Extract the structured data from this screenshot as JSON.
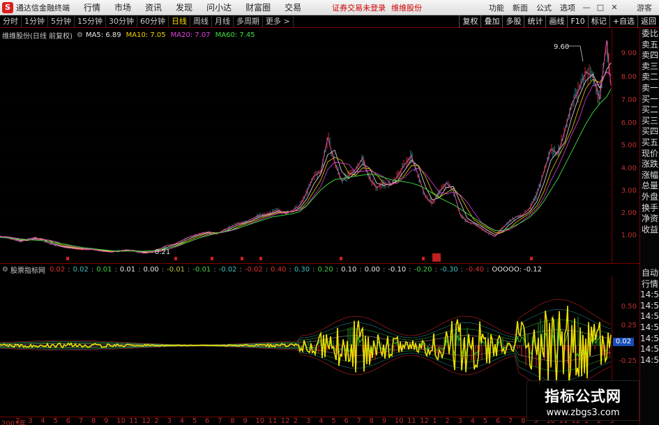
{
  "titlebar": {
    "app_name": "通达信金融终端",
    "logo_letter": "S",
    "menu": [
      "行情",
      "市场",
      "资讯",
      "发现",
      "问小达",
      "财富圈",
      "交易"
    ],
    "warning": "证券交易未登录",
    "stock_tag": "维维股份",
    "buttons": [
      "功能",
      "新面",
      "公式",
      "选项"
    ],
    "guest": "游客"
  },
  "toolbar": {
    "periods": [
      "分时",
      "1分钟",
      "5分钟",
      "15分钟",
      "30分钟",
      "60分钟",
      "日线",
      "周线",
      "月线",
      "多周期",
      "更多 >"
    ],
    "active_period": "日线",
    "right_buttons": [
      "复权",
      "叠加",
      "多股",
      "统计",
      "画线",
      "F10",
      "标记",
      "+自选",
      "返回"
    ]
  },
  "main_header": {
    "stock_name": "维维股份(日线 前复权)",
    "ma": [
      {
        "label": "MA5: 6.89",
        "color": "#e8e8e8"
      },
      {
        "label": "MA10: 7.05",
        "color": "#f0d000"
      },
      {
        "label": "MA20: 7.07",
        "color": "#e040e0"
      },
      {
        "label": "MA60: 7.45",
        "color": "#40e040"
      }
    ]
  },
  "main_axis": [
    "9.00",
    "8.00",
    "7.00",
    "6.00",
    "5.00",
    "4.00",
    "3.00",
    "2.00",
    "1.00"
  ],
  "annotations": {
    "high": "9.60",
    "low": "0.21"
  },
  "side_panel": {
    "top": [
      "委比",
      "卖五",
      "卖四",
      "卖三",
      "卖二",
      "卖一",
      "买一",
      "买二",
      "买三",
      "买四",
      "买五",
      "现价",
      "涨跌",
      "涨幅",
      "总量",
      "外盘",
      "换手",
      "净资",
      "收益"
    ],
    "bottom": [
      "自动",
      "行情",
      "14:50",
      "14:50",
      "14:50",
      "14:50",
      "14:50",
      "14:50",
      "14:50"
    ]
  },
  "indicator": {
    "name": "股票指标网",
    "values": [
      {
        "label": "0.02",
        "color": "#e03030"
      },
      {
        "label": "0.02",
        "color": "#40c0c0"
      },
      {
        "label": "0.01",
        "color": "#40d040"
      },
      {
        "label": "0.01",
        "color": "#e8e8e8"
      },
      {
        "label": "0.00",
        "color": "#e8e8e8"
      },
      {
        "label": "-0.01",
        "color": "#c0c040"
      },
      {
        "label": "-0.01",
        "color": "#40d040"
      },
      {
        "label": "-0.02",
        "color": "#40c0c0"
      },
      {
        "label": "-0.02",
        "color": "#e03030"
      },
      {
        "label": "0.40",
        "color": "#e03030"
      },
      {
        "label": "0.30",
        "color": "#40c0c0"
      },
      {
        "label": "0.20",
        "color": "#40d040"
      },
      {
        "label": "0.10",
        "color": "#e8e8e8"
      },
      {
        "label": "0.00",
        "color": "#e8e8e8"
      },
      {
        "label": "-0.10",
        "color": "#e8e8e8"
      },
      {
        "label": "-0.20",
        "color": "#40d040"
      },
      {
        "label": "-0.30",
        "color": "#40c0c0"
      },
      {
        "label": "-0.40",
        "color": "#e03030"
      },
      {
        "label": "OOOOO: -0.12",
        "color": "#e8e8e8"
      }
    ],
    "axis": [
      "0.50",
      "0.25",
      "-0.25"
    ],
    "current": "0.02"
  },
  "time_axis": [
    "2003年",
    "2",
    "3",
    "4",
    "5",
    "6",
    "7",
    "8",
    "9",
    "10",
    "11",
    "12",
    "2",
    "3",
    "4",
    "5",
    "6",
    "7",
    "8",
    "9",
    "10",
    "11",
    "12",
    "2",
    "3",
    "4",
    "5",
    "6",
    "7",
    "8",
    "9",
    "10",
    "11",
    "12",
    "1",
    "2",
    "3",
    "4",
    "5",
    "6",
    "7",
    "8",
    "9",
    "10",
    "11",
    "12",
    "1",
    "2",
    "3"
  ],
  "watermark": {
    "title": "指标公式网",
    "url": "www.zbgs3.com"
  },
  "chart_data": {
    "type": "line",
    "title": "维维股份(日线 前复权)",
    "ylim": [
      0,
      10
    ],
    "x": [
      0,
      10,
      20,
      30,
      40,
      50,
      60,
      70,
      80,
      90,
      100,
      110,
      120,
      130,
      140,
      150,
      160,
      170,
      180,
      190,
      200,
      210,
      220,
      230,
      240,
      250,
      260,
      270,
      280,
      290,
      300,
      310,
      320,
      330,
      340,
      350,
      360,
      370,
      380,
      390,
      400,
      410,
      420,
      430,
      440,
      450,
      460,
      470,
      480,
      490,
      500,
      510,
      520,
      530,
      540,
      550,
      560,
      570,
      580,
      590,
      600,
      610,
      620,
      630,
      640,
      650,
      660,
      670,
      680,
      690,
      700,
      710,
      720,
      730,
      740,
      750,
      760,
      770,
      780,
      790,
      800,
      810,
      820,
      830,
      840,
      850,
      860,
      870,
      876
    ],
    "series": [
      {
        "name": "price",
        "values": [
          0.95,
          0.9,
          0.8,
          0.72,
          0.82,
          0.9,
          0.78,
          0.65,
          0.55,
          0.48,
          0.43,
          0.4,
          0.37,
          0.38,
          0.33,
          0.28,
          0.26,
          0.3,
          0.35,
          0.32,
          0.24,
          0.21,
          0.3,
          0.4,
          0.55,
          0.6,
          0.75,
          0.9,
          1.0,
          1.1,
          1.15,
          1.05,
          1.2,
          1.35,
          1.5,
          1.55,
          1.7,
          1.85,
          1.9,
          2.0,
          2.1,
          1.95,
          2.1,
          2.3,
          2.9,
          3.6,
          3.8,
          5.3,
          4.2,
          3.4,
          3.6,
          3.9,
          4.4,
          3.5,
          3.1,
          3.3,
          3.2,
          3.6,
          4.1,
          4.5,
          3.6,
          2.7,
          2.4,
          2.9,
          3.3,
          3.0,
          1.9,
          1.6,
          1.5,
          1.3,
          1.1,
          0.95,
          1.3,
          1.6,
          1.8,
          1.9,
          2.2,
          2.8,
          3.8,
          4.8,
          4.6,
          5.6,
          6.8,
          7.4,
          8.2,
          8.0,
          7.0,
          9.6,
          7.6
        ]
      },
      {
        "name": "MA60",
        "values": [
          0.9,
          0.88,
          0.85,
          0.82,
          0.8,
          0.78,
          0.76,
          0.72,
          0.68,
          0.62,
          0.56,
          0.5,
          0.45,
          0.42,
          0.38,
          0.35,
          0.32,
          0.3,
          0.3,
          0.3,
          0.29,
          0.3,
          0.32,
          0.36,
          0.42,
          0.5,
          0.6,
          0.7,
          0.82,
          0.92,
          1.0,
          1.08,
          1.15,
          1.22,
          1.3,
          1.4,
          1.5,
          1.6,
          1.7,
          1.8,
          1.85,
          1.9,
          1.95,
          2.05,
          2.3,
          2.65,
          3.0,
          3.25,
          3.45,
          3.5,
          3.55,
          3.6,
          3.65,
          3.7,
          3.65,
          3.55,
          3.45,
          3.4,
          3.35,
          3.3,
          3.2,
          3.05,
          2.85,
          2.65,
          2.5,
          2.35,
          2.15,
          1.95,
          1.75,
          1.55,
          1.35,
          1.2,
          1.2,
          1.3,
          1.45,
          1.6,
          1.8,
          2.1,
          2.5,
          3.0,
          3.5,
          4.1,
          4.7,
          5.3,
          5.9,
          6.4,
          6.8,
          7.1,
          7.45
        ]
      }
    ]
  }
}
